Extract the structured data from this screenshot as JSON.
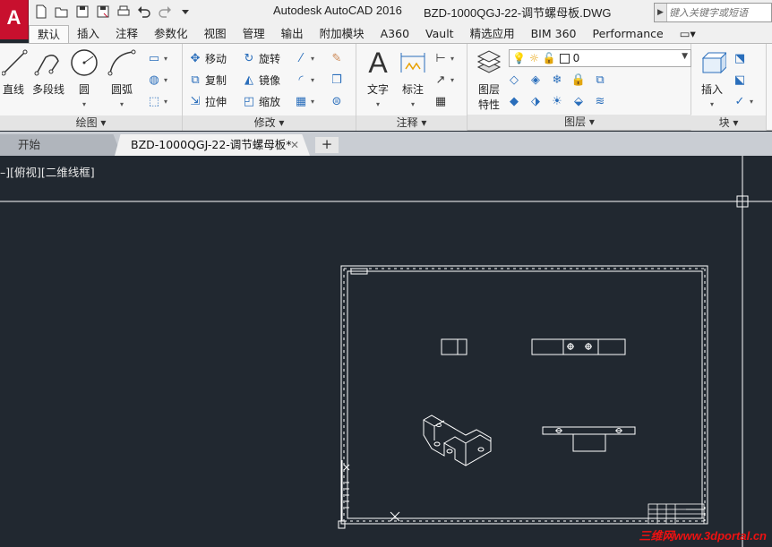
{
  "app": {
    "title": "Autodesk AutoCAD 2016",
    "file": "BZD-1000QGJ-22-调节螺母板.DWG",
    "app_button": "A",
    "search_placeholder": "键入关键字或短语"
  },
  "ribbon_tabs": [
    "默认",
    "插入",
    "注释",
    "参数化",
    "视图",
    "管理",
    "输出",
    "附加模块",
    "A360",
    "Vault",
    "精选应用",
    "BIM 360",
    "Performance",
    "▭▾"
  ],
  "draw_panel": {
    "title": "绘图 ▾",
    "line": "直线",
    "polyline": "多段线",
    "circle": "圆",
    "arc": "圆弧"
  },
  "modify_panel": {
    "title": "修改 ▾",
    "move": "移动",
    "rotate": "旋转",
    "copy": "复制",
    "mirror": "镜像",
    "stretch": "拉伸",
    "scale": "缩放"
  },
  "annotation_panel": {
    "title": "注释 ▾",
    "text": "文字",
    "dimension": "标注"
  },
  "layers_panel": {
    "title": "图层 ▾",
    "properties_line1": "图层",
    "properties_line2": "特性",
    "current_layer": "0"
  },
  "block_panel": {
    "title": "块 ▾",
    "insert": "插入"
  },
  "file_tabs": {
    "start": "开始",
    "active": "BZD-1000QGJ-22-调节螺母板*",
    "close": "✕",
    "new_tab": "+"
  },
  "viewport": {
    "label": "–][俯视][二维线框]"
  },
  "watermark": "三维网www.3dportal.cn",
  "colors": {
    "app_red": "#c8102e",
    "canvas_bg": "#212830",
    "drawing_lines": "#ffffff"
  }
}
